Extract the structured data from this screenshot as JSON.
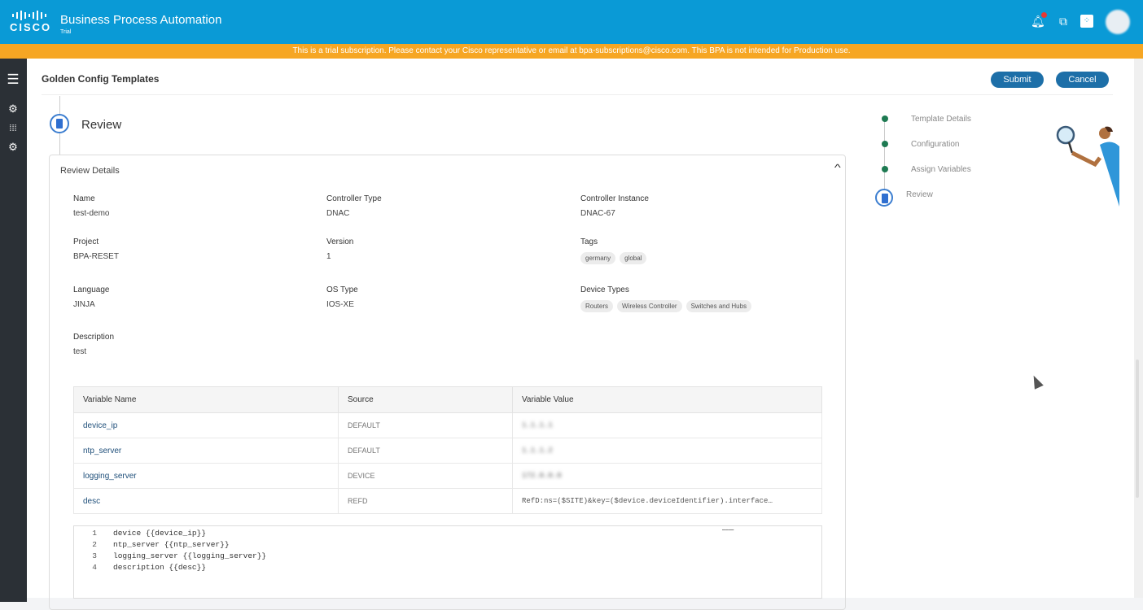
{
  "header": {
    "logo_text": "cisco",
    "title": "Business Process Automation",
    "subtitle": "Trial",
    "icons": [
      "bell-icon",
      "external-link-icon",
      "apps-icon",
      "avatar"
    ]
  },
  "banner": "This is a trial subscription. Please contact your Cisco representative or email at bpa-subscriptions@cisco.com. This BPA is not intended for Production use.",
  "page": {
    "title": "Golden Config Templates",
    "submit": "Submit",
    "cancel": "Cancel",
    "step_title": "Review"
  },
  "review": {
    "section_title": "Review Details",
    "fields": {
      "name": {
        "label": "Name",
        "value": "test-demo"
      },
      "controller_type": {
        "label": "Controller Type",
        "value": "DNAC"
      },
      "controller_instance": {
        "label": "Controller Instance",
        "value": "DNAC-67"
      },
      "project": {
        "label": "Project",
        "value": "BPA-RESET"
      },
      "version": {
        "label": "Version",
        "value": "1"
      },
      "tags": {
        "label": "Tags",
        "values": [
          "germany",
          "global"
        ]
      },
      "language": {
        "label": "Language",
        "value": "JINJA"
      },
      "os_type": {
        "label": "OS Type",
        "value": "IOS-XE"
      },
      "device_types": {
        "label": "Device Types",
        "values": [
          "Routers",
          "Wireless Controller",
          "Switches and Hubs"
        ]
      },
      "description": {
        "label": "Description",
        "value": "test"
      }
    },
    "table": {
      "headers": [
        "Variable Name",
        "Source",
        "Variable Value"
      ],
      "rows": [
        {
          "name": "device_ip",
          "source": "DEFAULT",
          "value": "1.1.1.1"
        },
        {
          "name": "ntp_server",
          "source": "DEFAULT",
          "value": "1.1.1.2"
        },
        {
          "name": "logging_server",
          "source": "DEVICE",
          "value": "172.0.0.0"
        },
        {
          "name": "desc",
          "source": "REFD",
          "value": "RefD:ns=($SITE)&key=($device.deviceIdentifier).interface…"
        }
      ]
    },
    "code": [
      {
        "n": "1",
        "text": "device {{device_ip}}"
      },
      {
        "n": "2",
        "text": "ntp_server {{ntp_server}}"
      },
      {
        "n": "3",
        "text": "logging_server {{logging_server}}"
      },
      {
        "n": "4",
        "text": "description {{desc}}"
      }
    ]
  },
  "steps": [
    "Template Details",
    "Configuration",
    "Assign Variables",
    "Review"
  ]
}
